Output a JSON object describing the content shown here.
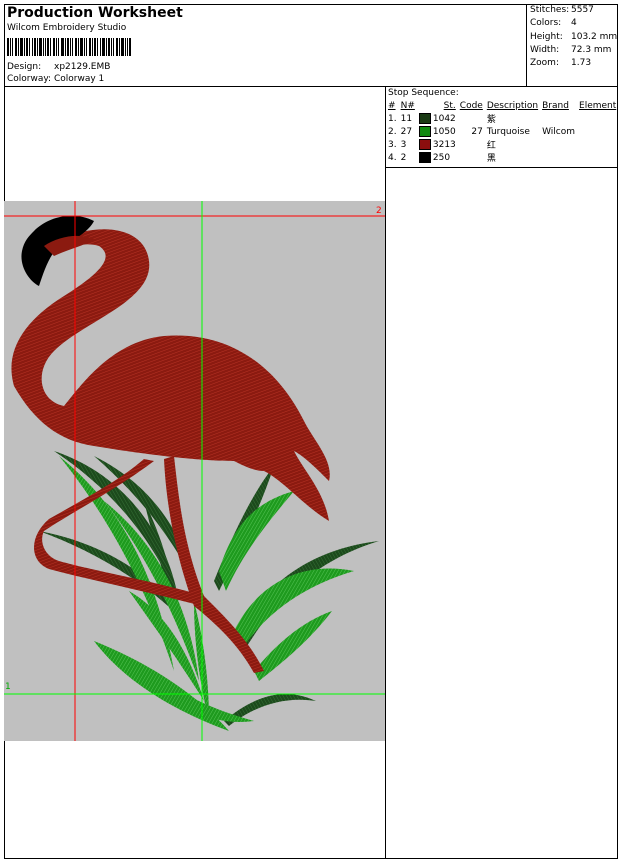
{
  "header": {
    "title": "Production Worksheet",
    "subtitle": "Wilcom Embroidery Studio",
    "design_label": "Design:",
    "design_value": "xp2129.EMB",
    "colorway_label": "Colorway:",
    "colorway_value": "Colorway 1"
  },
  "stats": [
    {
      "label": "Stitches:",
      "value": "5557"
    },
    {
      "label": "Colors:",
      "value": "4"
    },
    {
      "label": "Height:",
      "value": "103.2 mm"
    },
    {
      "label": "Width:",
      "value": "72.3 mm"
    },
    {
      "label": "Zoom:",
      "value": "1.73"
    }
  ],
  "stop_sequence": {
    "title": "Stop Sequence:",
    "columns": [
      "#",
      "N#",
      "St.",
      "Code",
      "Description",
      "Brand",
      "Element"
    ],
    "rows": [
      {
        "idx": "1.",
        "n": "11",
        "st": "1042",
        "code": "",
        "desc": "紫",
        "brand": "",
        "element": "",
        "color": "#1a3a14"
      },
      {
        "idx": "2.",
        "n": "27",
        "st": "1050",
        "code": "27",
        "desc": "Turquoise",
        "brand": "Wilcom",
        "element": "",
        "color": "#108a10"
      },
      {
        "idx": "3.",
        "n": "3",
        "st": "3213",
        "code": "",
        "desc": "红",
        "brand": "",
        "element": "",
        "color": "#8b0e0e"
      },
      {
        "idx": "4.",
        "n": "2",
        "st": "250",
        "code": "",
        "desc": "黑",
        "brand": "",
        "element": "",
        "color": "#000000"
      }
    ]
  },
  "canvas": {
    "corner_top_right": "2",
    "corner_bottom_left": "1",
    "background": "#c0c0c0",
    "flamingo_color": "#8b1a10",
    "head_color": "#000000",
    "leaf_light": "#1e9a1e",
    "leaf_dark": "#1c4a1c",
    "guide_red": "#ff0000",
    "guide_green": "#00ff00"
  }
}
